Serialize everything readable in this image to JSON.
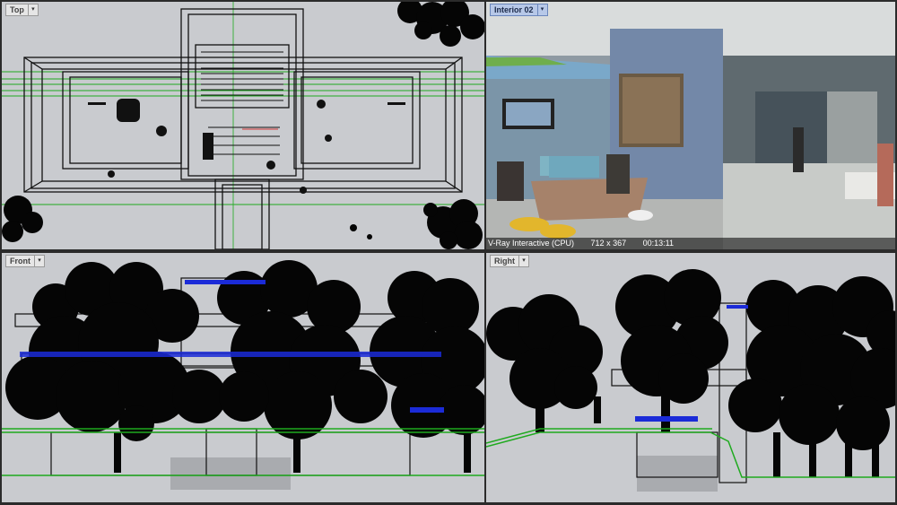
{
  "viewports": {
    "top": {
      "label": "Top"
    },
    "interior": {
      "label": "Interior 02"
    },
    "front": {
      "label": "Front"
    },
    "right": {
      "label": "Right"
    }
  },
  "render_status": {
    "engine": "V-Ray Interactive (CPU)",
    "resolution": "712 x 367",
    "elapsed": "00:13:11"
  },
  "icons": {
    "dropdown": "chevron-down-icon"
  },
  "colors": {
    "viewport_bg": "#c9cbcf",
    "active_tab": "#b7c8e8",
    "ground_line": "#1faa1f",
    "railing_blue": "#1b2bd8"
  }
}
